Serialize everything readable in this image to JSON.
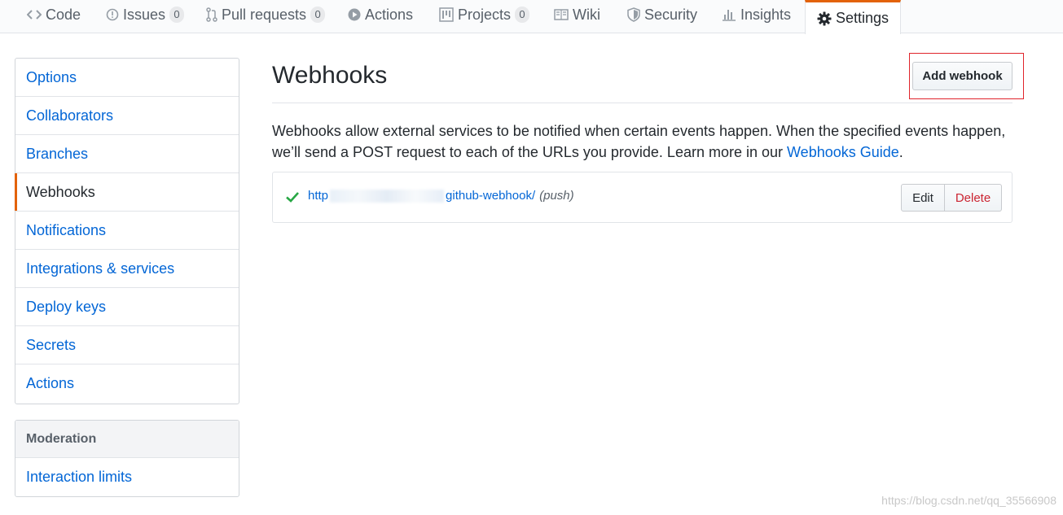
{
  "nav": {
    "tabs": [
      {
        "label": "Code",
        "icon": "code-icon"
      },
      {
        "label": "Issues",
        "icon": "issue-icon",
        "count": "0"
      },
      {
        "label": "Pull requests",
        "icon": "pull-request-icon",
        "count": "0"
      },
      {
        "label": "Actions",
        "icon": "play-icon"
      },
      {
        "label": "Projects",
        "icon": "project-icon",
        "count": "0"
      },
      {
        "label": "Wiki",
        "icon": "book-icon"
      },
      {
        "label": "Security",
        "icon": "shield-icon"
      },
      {
        "label": "Insights",
        "icon": "graph-icon"
      },
      {
        "label": "Settings",
        "icon": "gear-icon",
        "selected": true
      }
    ]
  },
  "sidebar": {
    "items": [
      "Options",
      "Collaborators",
      "Branches",
      "Webhooks",
      "Notifications",
      "Integrations & services",
      "Deploy keys",
      "Secrets",
      "Actions"
    ],
    "selected": "Webhooks",
    "moderation": {
      "heading": "Moderation",
      "items": [
        "Interaction limits"
      ]
    }
  },
  "main": {
    "title": "Webhooks",
    "add_button": "Add webhook",
    "description": "Webhooks allow external services to be notified when certain events happen. When the specified events happen, we’ll send a POST request to each of the URLs you provide. Learn more in our ",
    "guide_link": "Webhooks Guide",
    "description_end": ".",
    "webhook": {
      "url_start": "http",
      "url_end": "github-webhook/",
      "events": "(push)",
      "status": "success"
    },
    "edit_button": "Edit",
    "delete_button": "Delete"
  },
  "watermark": "https://blog.csdn.net/qq_35566908",
  "colors": {
    "accent": "#e36209",
    "link": "#0366d6",
    "success": "#28a745",
    "danger": "#cb2431",
    "highlight": "#e0242b"
  }
}
